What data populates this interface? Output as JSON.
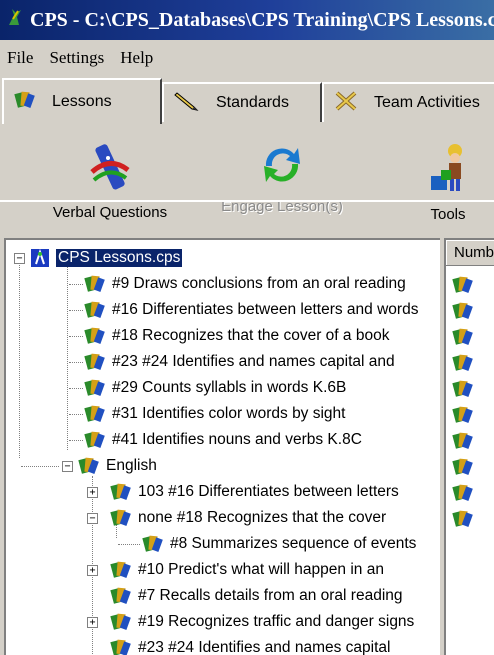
{
  "window": {
    "title": "CPS - C:\\CPS_Databases\\CPS Training\\CPS Lessons.cps"
  },
  "menu": {
    "items": [
      "File",
      "Settings",
      "Help"
    ]
  },
  "tabs": [
    {
      "label": "Lessons",
      "icon": "lessons-icon",
      "active": true
    },
    {
      "label": "Standards",
      "icon": "pencil-icon",
      "active": false
    },
    {
      "label": "Team Activities",
      "icon": "team-activities-icon",
      "active": false
    }
  ],
  "toolbar": {
    "verbal_questions": "Verbal Questions",
    "engage_lessons": "Engage Lesson(s)",
    "tools": "Tools"
  },
  "tree": {
    "root": "CPS Lessons.cps",
    "top_items": [
      "#9 Draws conclusions from an oral reading",
      "#16 Differentiates between letters and words",
      "#18 Recognizes that the cover of a book",
      "#23 #24 Identifies and names capital and",
      "#29 Counts syllabls in words K.6B",
      "#31 Identifies color words by sight",
      "#41 Identifies nouns and verbs K.8C"
    ],
    "folder": "English",
    "english_items": [
      "103 #16 Differentiates between letters",
      "none #18 Recognizes that the cover",
      "#8 Summarizes sequence of events",
      "#10 Predict's what will happen in an",
      "#7 Recalls details from an oral reading",
      "#19 Recognizes traffic and danger signs",
      "#23 #24 Identifies and names capital"
    ]
  },
  "right_panel": {
    "column_header": "Number",
    "row_icon_count": 10
  },
  "colors": {
    "title_bar": "#0a246a",
    "selection": "#0a246a",
    "face": "#d4d0c8"
  }
}
